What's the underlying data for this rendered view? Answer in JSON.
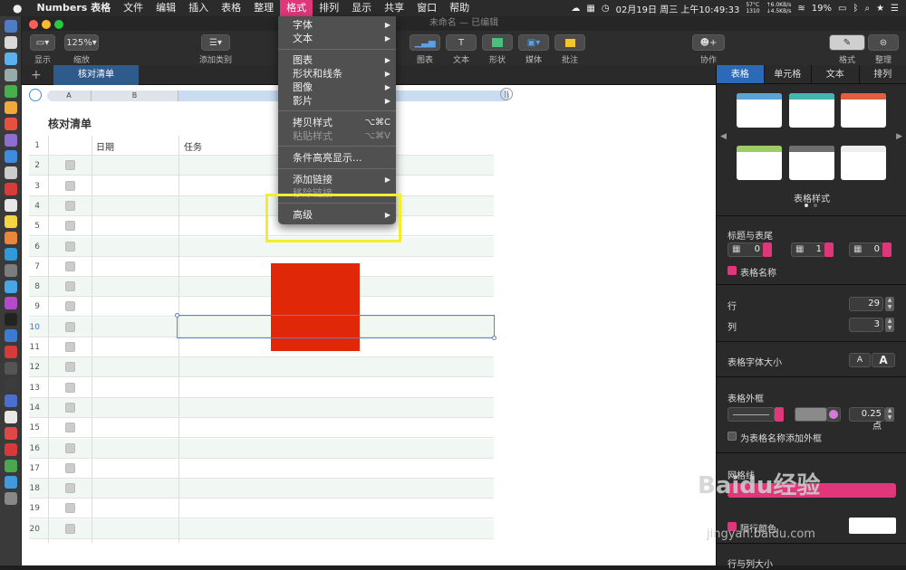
{
  "menubar": {
    "app_name": "Numbers 表格",
    "items": [
      "文件",
      "编辑",
      "插入",
      "表格",
      "整理",
      "格式",
      "排列",
      "显示",
      "共享",
      "窗口",
      "帮助"
    ],
    "active": "格式",
    "temperature": "57°C",
    "fan": "1310",
    "net_up": "↑6.0KB/s",
    "net_down": "↓4.5KB/s",
    "datetime": "02月19日 周三 上午10:49:33",
    "battery": "19%"
  },
  "window": {
    "title": "未命名 — 已编辑"
  },
  "toolbar": {
    "view_label": "显示",
    "zoom_value": "125%",
    "zoom_label": "缩放",
    "add_category_label": "添加类别",
    "chart_label": "图表",
    "text_label": "文本",
    "shape_label": "形状",
    "media_label": "媒体",
    "comment_label": "批注",
    "collaborate_label": "协作",
    "format_label": "格式",
    "organize_label": "整理"
  },
  "sheet": {
    "tab_name": "核对清单",
    "add_tab": "+",
    "col_a": "A",
    "col_b": "B",
    "table_title": "核对清单",
    "headers": [
      "日期",
      "任务"
    ],
    "row_numbers": [
      "1",
      "2",
      "3",
      "4",
      "5",
      "6",
      "7",
      "8",
      "9",
      "10",
      "11",
      "12",
      "13",
      "14",
      "15",
      "16",
      "17",
      "18",
      "19",
      "20"
    ],
    "selected_row": "10"
  },
  "format_menu": {
    "items": [
      {
        "label": "字体",
        "submenu": true
      },
      {
        "label": "文本",
        "submenu": true
      },
      {
        "label": "图表",
        "submenu": true
      },
      {
        "label": "形状和线条",
        "submenu": true
      },
      {
        "label": "图像",
        "submenu": true
      },
      {
        "label": "影片",
        "submenu": true
      },
      {
        "label": "拷贝样式",
        "shortcut": "⌥⌘C"
      },
      {
        "label": "粘贴样式",
        "shortcut": "⌥⌘V",
        "disabled": true
      },
      {
        "label": "条件高亮显示...",
        "submenu": false
      },
      {
        "label": "添加链接",
        "submenu": true
      },
      {
        "label": "移除链接",
        "disabled": true
      },
      {
        "label": "高级",
        "submenu": true
      }
    ]
  },
  "panel": {
    "tabs": [
      "表格",
      "单元格",
      "文本",
      "排列"
    ],
    "active_tab": "表格",
    "table_styles_label": "表格样式",
    "header_footer_label": "标题与表尾",
    "header_rows": "0",
    "header_cols": "1",
    "footer_rows": "0",
    "table_name_label": "表格名称",
    "rows_label": "行",
    "rows_value": "29",
    "cols_label": "列",
    "cols_value": "3",
    "font_size_label": "表格字体大小",
    "font_small": "A",
    "font_large": "A",
    "border_label": "表格外框",
    "border_width": "0.25 点",
    "add_border_label": "为表格名称添加外框",
    "gridlines_label": "网格线",
    "alt_row_label": "隔行颜色",
    "row_col_size_label": "行与列大小"
  },
  "watermark": {
    "main": "Baidu经验",
    "sub": "jingyan.baidu.com"
  },
  "colors": {
    "accent_pink": "#e0367a",
    "selection_blue": "#2c6ab8",
    "red_shape": "#e02707",
    "highlight_yellow": "#f4ee2a"
  }
}
